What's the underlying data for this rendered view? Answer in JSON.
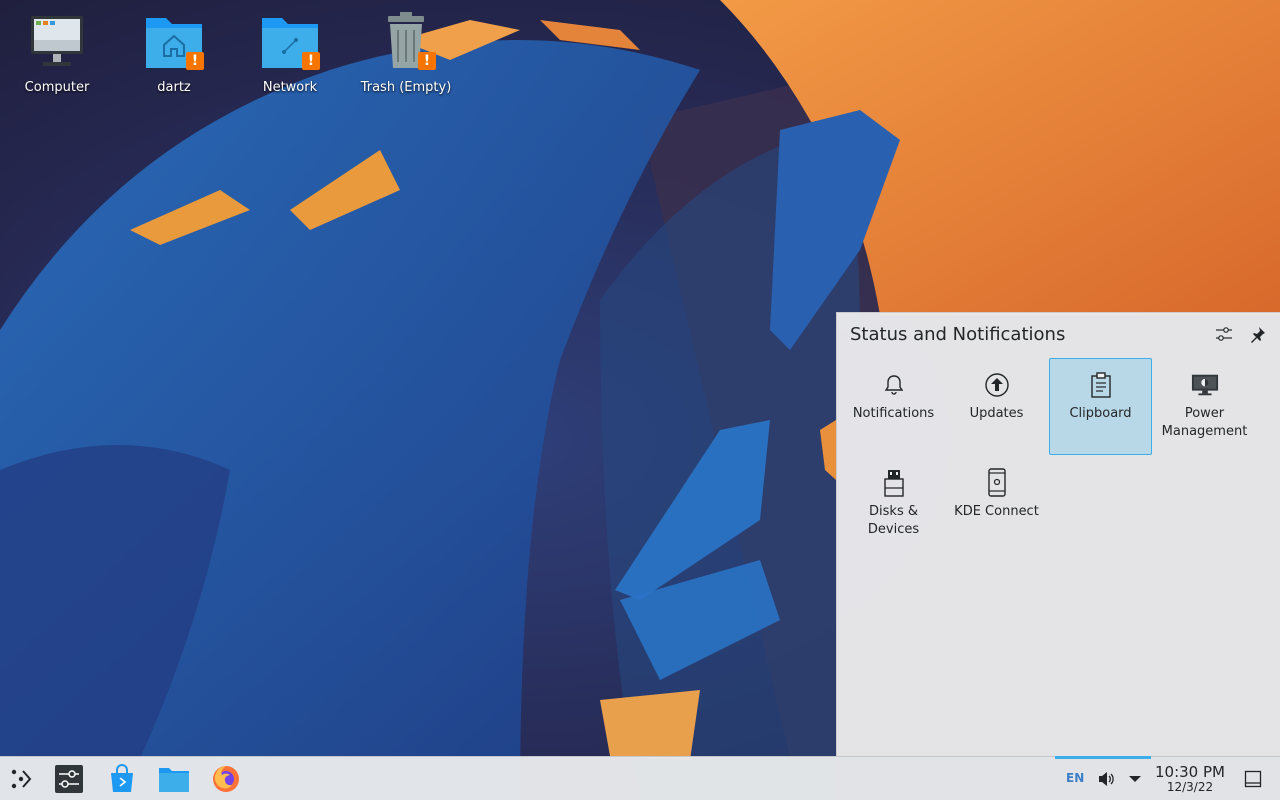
{
  "desktop": {
    "icons": [
      {
        "label": "Computer",
        "icon": "computer-icon"
      },
      {
        "label": "dartz",
        "icon": "home-folder-icon",
        "badge": "!"
      },
      {
        "label": "Network",
        "icon": "network-folder-icon",
        "badge": "!"
      },
      {
        "label": "Trash (Empty)",
        "icon": "trash-icon",
        "badge": "!"
      }
    ]
  },
  "popup": {
    "title": "Status and Notifications",
    "header_buttons": [
      "configure-icon",
      "pin-icon"
    ],
    "items": [
      {
        "label": "Notifications",
        "icon": "bell-icon",
        "selected": false
      },
      {
        "label": "Updates",
        "icon": "update-arrow-icon",
        "selected": false
      },
      {
        "label": "Clipboard",
        "icon": "clipboard-icon",
        "selected": true
      },
      {
        "label": "Power Management",
        "icon": "monitor-brightness-icon",
        "selected": false
      },
      {
        "label": "Disks & Devices",
        "icon": "usb-drive-icon",
        "selected": false
      },
      {
        "label": "KDE Connect",
        "icon": "phone-icon",
        "selected": false
      }
    ]
  },
  "taskbar": {
    "launchers": [
      "app-launcher-icon",
      "system-settings-icon",
      "discover-icon",
      "dolphin-icon",
      "firefox-icon"
    ],
    "tray": {
      "keyboard_layout": "EN",
      "icons": [
        "volume-icon",
        "expand-tray-arrow-icon"
      ],
      "clock_time": "10:30 PM",
      "clock_date": "12/3/22"
    },
    "show_desktop_icon": "show-desktop-icon"
  },
  "colors": {
    "accent": "#3daee9",
    "warning": "#f67400",
    "wallpaper_orange": "#e9833a",
    "wallpaper_blue": "#2a69b3"
  }
}
